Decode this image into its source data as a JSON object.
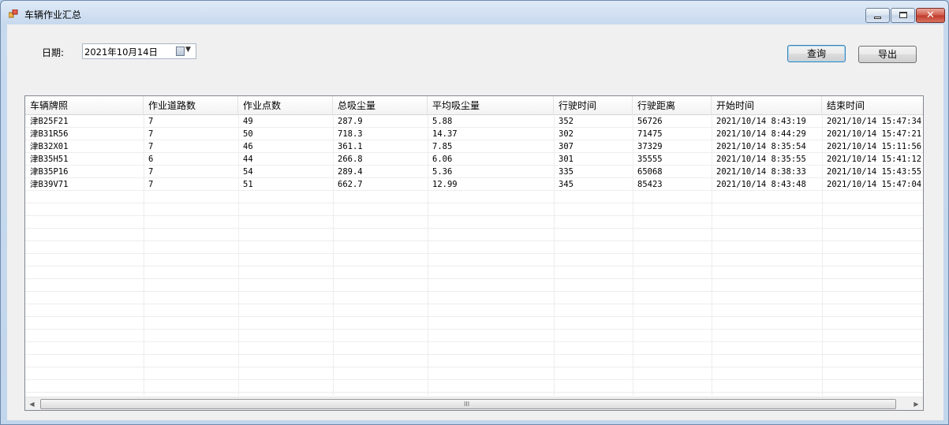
{
  "window": {
    "title": "车辆作业汇总"
  },
  "filter": {
    "date_label": "日期:",
    "date_value": "2021年10月14日"
  },
  "buttons": {
    "query": "查询",
    "export": "导出"
  },
  "grid": {
    "columns": [
      "车辆牌照",
      "作业道路数",
      "作业点数",
      "总吸尘量",
      "平均吸尘量",
      "行驶时间",
      "行驶距离",
      "开始时间",
      "结束时间"
    ],
    "rows": [
      [
        "津B25F21",
        "7",
        "49",
        "287.9",
        "5.88",
        "352",
        "56726",
        "2021/10/14 8:43:19",
        "2021/10/14 15:47:34"
      ],
      [
        "津B31R56",
        "7",
        "50",
        "718.3",
        "14.37",
        "302",
        "71475",
        "2021/10/14 8:44:29",
        "2021/10/14 15:47:21"
      ],
      [
        "津B32X01",
        "7",
        "46",
        "361.1",
        "7.85",
        "307",
        "37329",
        "2021/10/14 8:35:54",
        "2021/10/14 15:11:56"
      ],
      [
        "津B35H51",
        "6",
        "44",
        "266.8",
        "6.06",
        "301",
        "35555",
        "2021/10/14 8:35:55",
        "2021/10/14 15:41:12"
      ],
      [
        "津B35P16",
        "7",
        "54",
        "289.4",
        "5.36",
        "335",
        "65068",
        "2021/10/14 8:38:33",
        "2021/10/14 15:43:55"
      ],
      [
        "津B39V71",
        "7",
        "51",
        "662.7",
        "12.99",
        "345",
        "85423",
        "2021/10/14 8:43:48",
        "2021/10/14 15:47:04"
      ]
    ]
  },
  "scrollbar": {
    "grip": "III",
    "left_arrow": "◀",
    "right_arrow": "▶"
  },
  "window_controls": {
    "close_glyph": "✕"
  },
  "icons": {
    "app": "app-icon",
    "calendar": "calendar-icon",
    "dropdown": "chevron-down-icon"
  }
}
